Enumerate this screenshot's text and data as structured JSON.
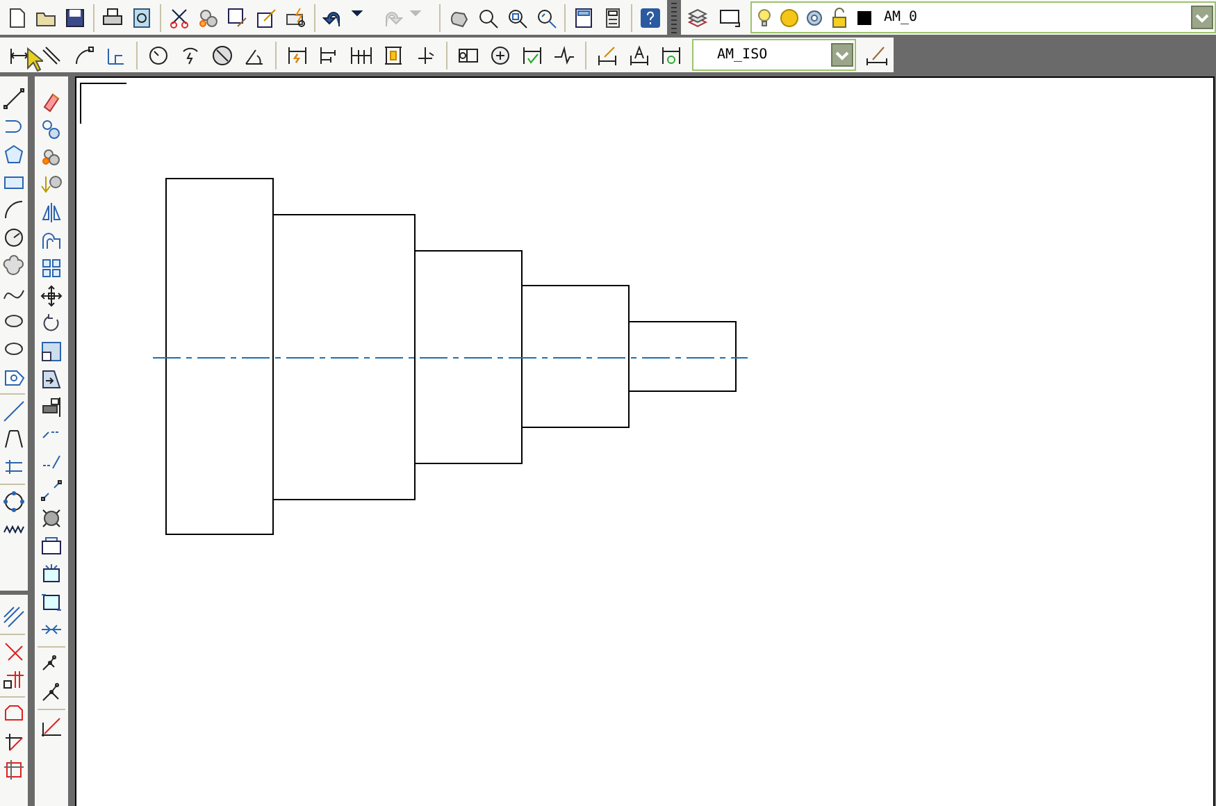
{
  "layer_control": {
    "value": "AM_0"
  },
  "dimension_style_control": {
    "value": "AM_ISO"
  }
}
